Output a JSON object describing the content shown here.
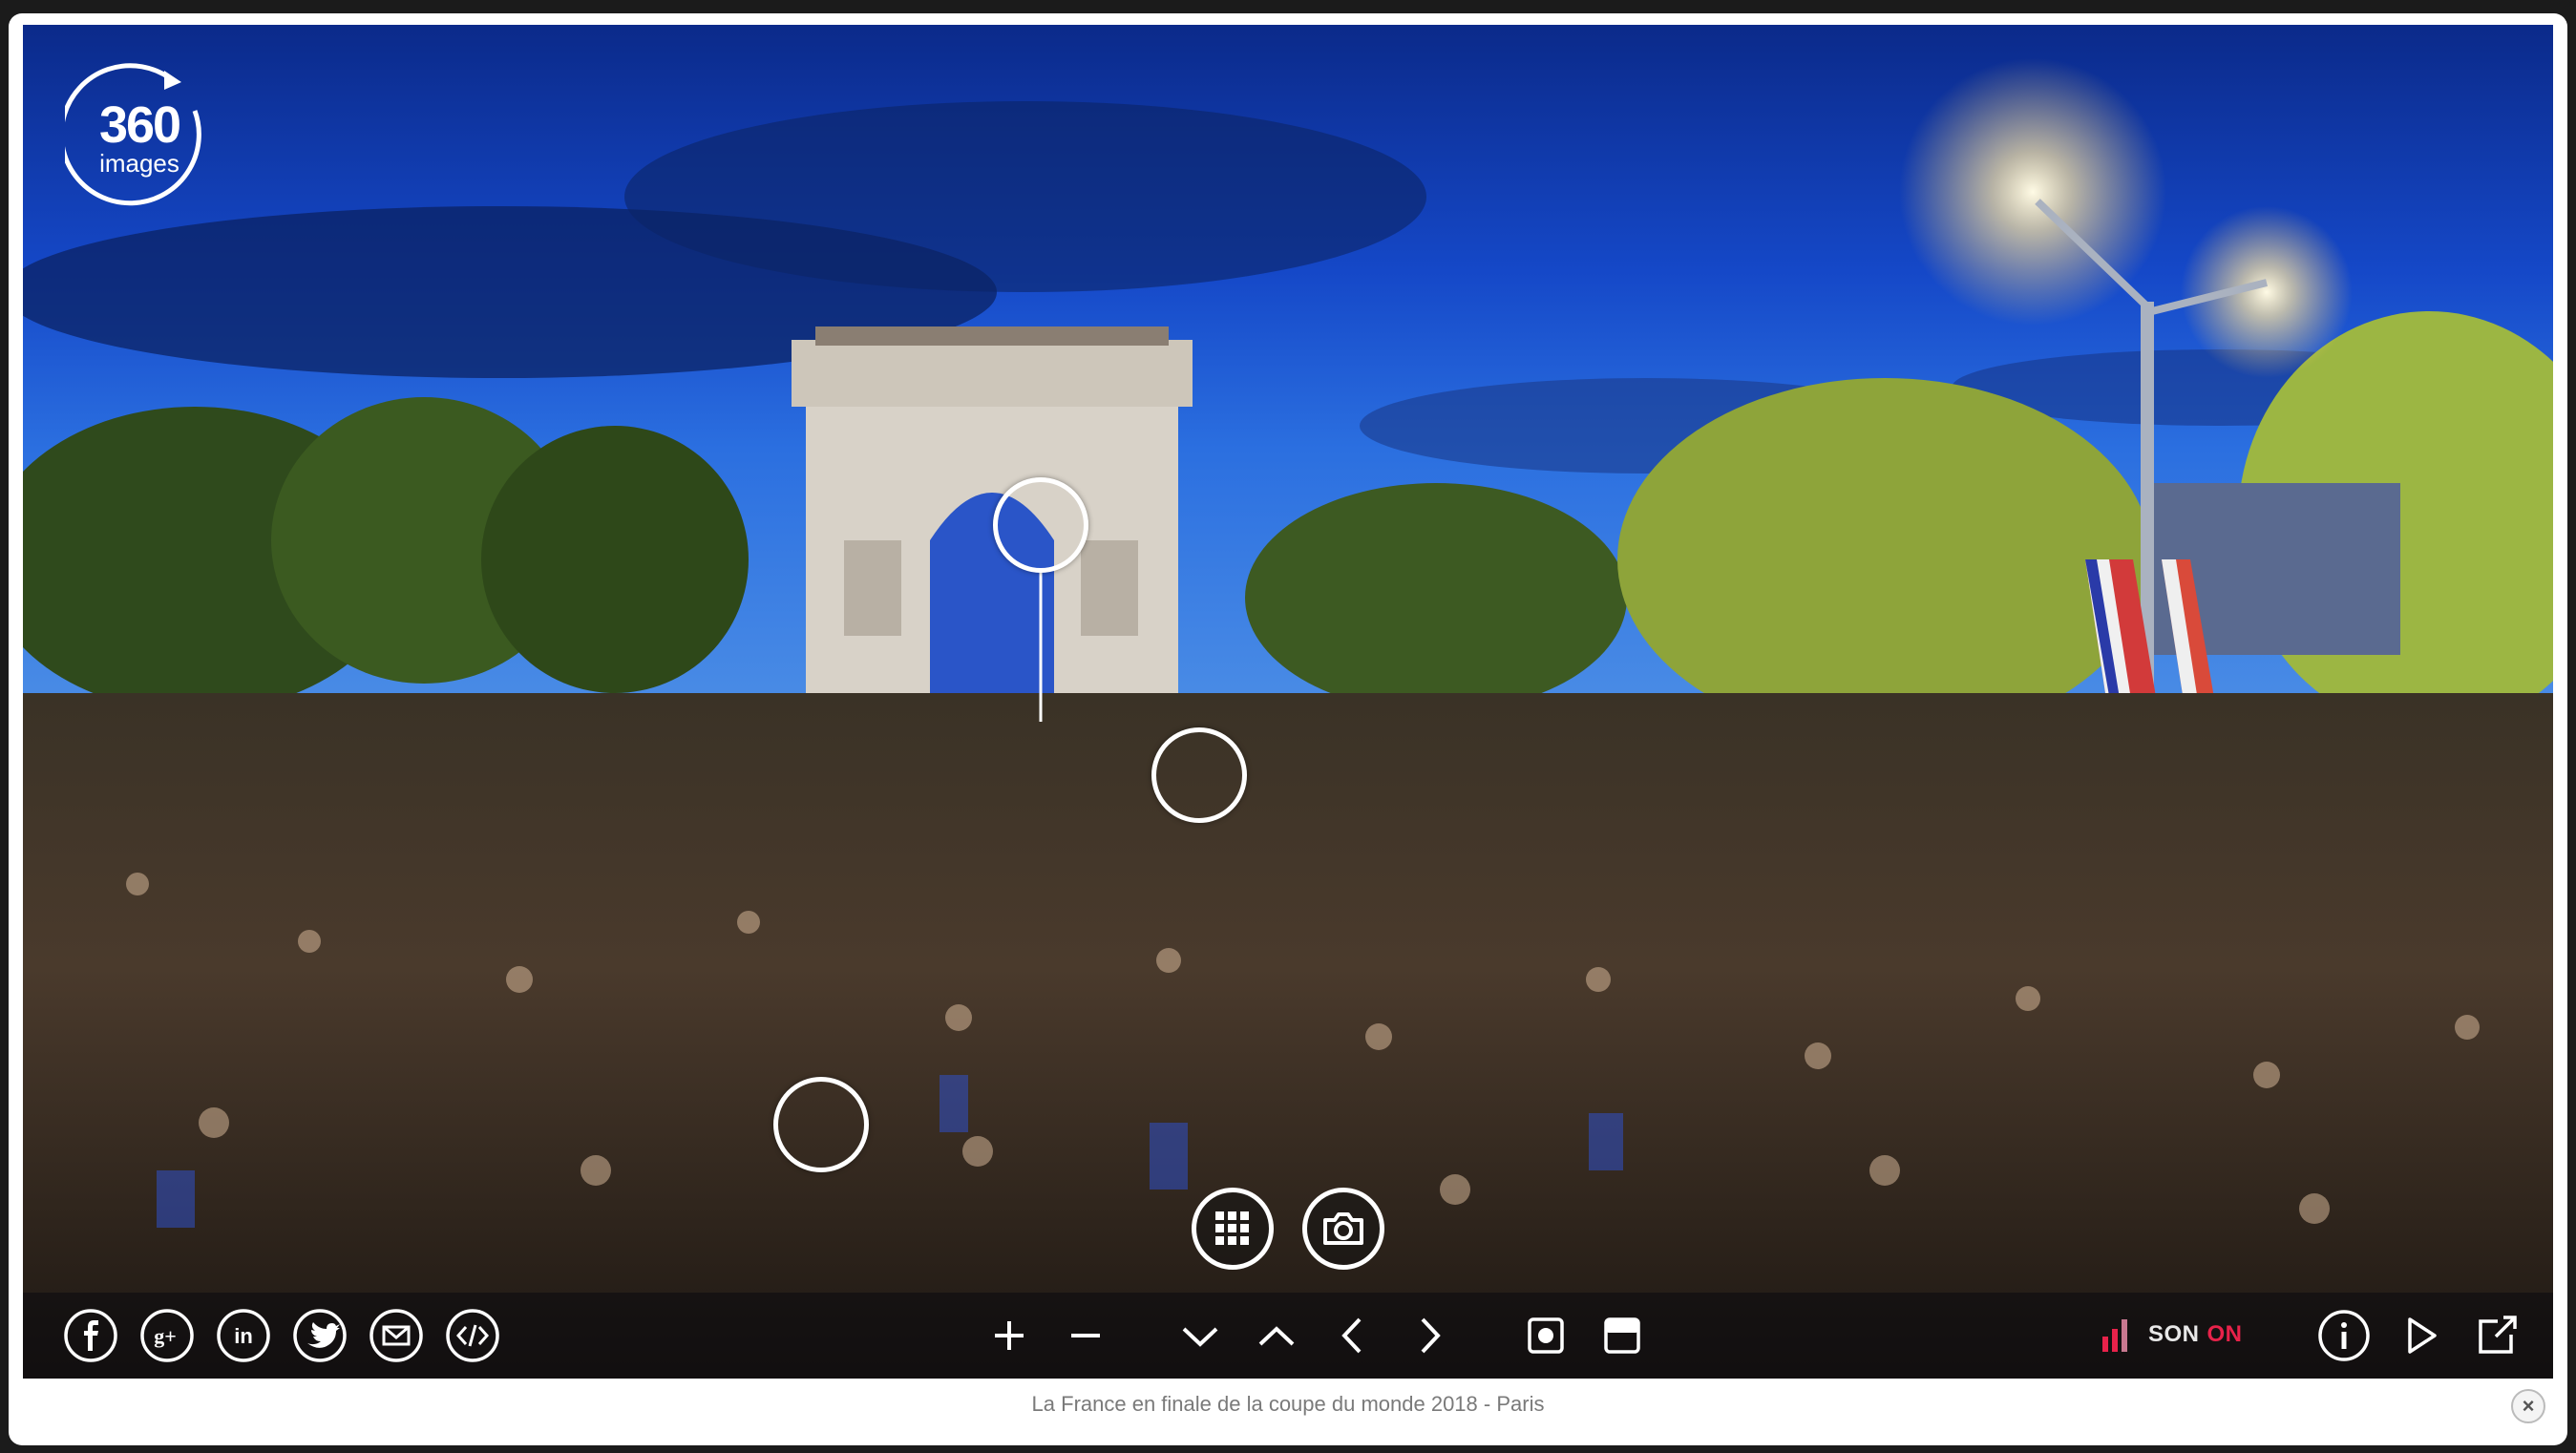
{
  "logo": {
    "number": "360",
    "word": "images"
  },
  "caption": "La France en finale de la coupe du monde 2018 - Paris",
  "sound": {
    "label": "SON",
    "state": "ON"
  },
  "close": {
    "symbol": "×"
  },
  "colors": {
    "accent_sound_on": "#e8224a",
    "toolbar_icons": "#ffffff",
    "caption_text": "#7a7a7a"
  },
  "toolbar": {
    "share_icons": [
      "facebook-icon",
      "google-plus-icon",
      "linkedin-icon",
      "twitter-icon",
      "email-icon",
      "embed-code-icon"
    ],
    "navigation_icons": [
      "zoom-in-icon",
      "zoom-out-icon",
      "look-down-icon",
      "look-up-icon",
      "look-left-icon",
      "look-right-icon"
    ],
    "view_icons": [
      "view-mode-icon",
      "projection-icon"
    ],
    "right_icons": [
      "sound-level-icon",
      "info-icon",
      "play-icon",
      "fullscreen-icon"
    ]
  },
  "center_buttons": [
    "gallery-grid-icon",
    "camera-icon"
  ]
}
